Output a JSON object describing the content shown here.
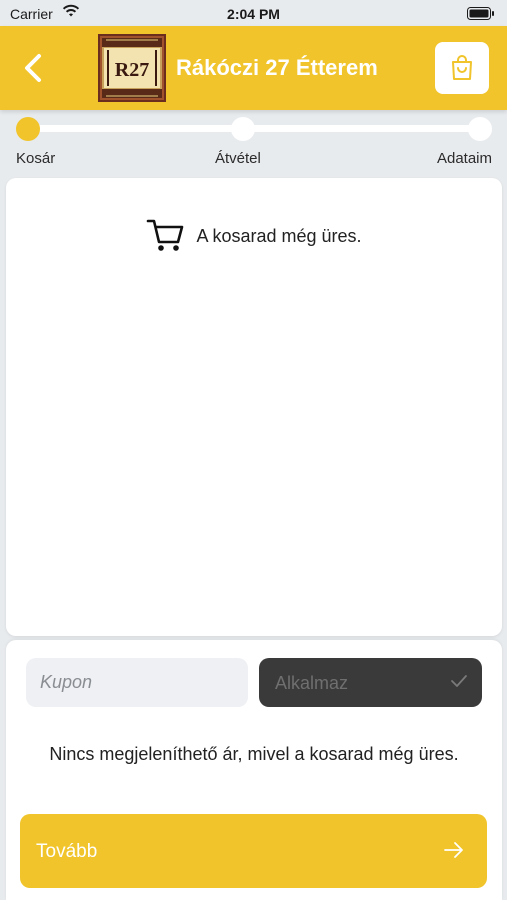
{
  "status_bar": {
    "carrier": "Carrier",
    "time": "2:04 PM"
  },
  "header": {
    "title": "Rákóczi 27 Étterem",
    "logo_text": "R27",
    "brand_color": "#f0c42a"
  },
  "stepper": {
    "steps": [
      {
        "label": "Kosár",
        "active": true
      },
      {
        "label": "Átvétel",
        "active": false
      },
      {
        "label": "Adataim",
        "active": false
      }
    ]
  },
  "cart": {
    "empty_message": "A kosarad még üres.",
    "icon": "shopping-cart-icon"
  },
  "coupon": {
    "placeholder": "Kupon",
    "value": "",
    "apply_label": "Alkalmaz"
  },
  "info": {
    "no_price_text": "Nincs megjeleníthető ár, mivel a kosarad még üres."
  },
  "next": {
    "label": "Tovább"
  },
  "colors": {
    "accent": "#f0c42a",
    "dark_button": "#3a3a3a",
    "background": "#e8ebee"
  }
}
